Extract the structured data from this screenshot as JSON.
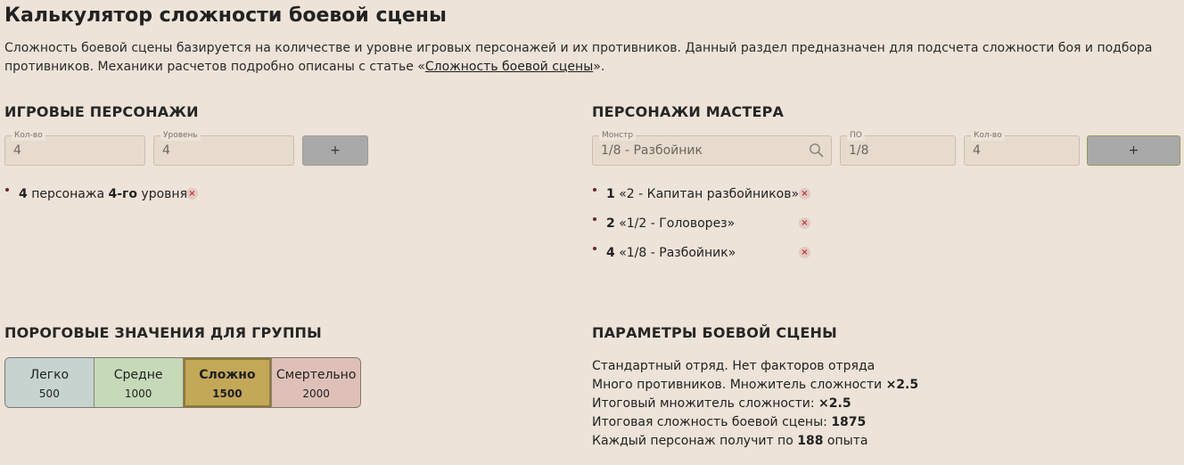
{
  "page": {
    "title": "Калькулятор сложности боевой сцены",
    "intro_text": "Сложность боевой сцены базируется на количестве и уровне игровых персонажей и их противников. Данный раздел предназначен для подсчета сложности боя и подбора противников. Механики расчетов подробно описаны с статье «",
    "intro_link": "Сложность боевой сцены",
    "intro_end": "»."
  },
  "players": {
    "heading": "ИГРОВЫЕ ПЕРСОНАЖИ",
    "count_label": "Кол-во",
    "count_value": "4",
    "level_label": "Уровень",
    "level_value": "4",
    "add_label": "+",
    "items": [
      {
        "count": "4",
        "mid": " персонажа ",
        "level": "4-го",
        "end": " уровня"
      }
    ]
  },
  "monsters": {
    "heading": "ПЕРСОНАЖИ МАСТЕРА",
    "monster_label": "Монстр",
    "monster_value": "1/8 - Разбойник",
    "cr_label": "ПО",
    "cr_value": "1/8",
    "count_label": "Кол-во",
    "count_value": "4",
    "add_label": "+",
    "items": [
      {
        "count": "1",
        "name": " «2 - Капитан разбойников»"
      },
      {
        "count": "2",
        "name": " «1/2 - Головорез»"
      },
      {
        "count": "4",
        "name": " «1/8 - Разбойник»"
      }
    ]
  },
  "thresholds": {
    "heading": "ПОРОГОВЫЕ ЗНАЧЕНИЯ ДЛЯ ГРУППЫ",
    "items": [
      {
        "name": "Легко",
        "value": "500"
      },
      {
        "name": "Средне",
        "value": "1000"
      },
      {
        "name": "Сложно",
        "value": "1500"
      },
      {
        "name": "Смертельно",
        "value": "2000"
      }
    ],
    "selected": "Сложно"
  },
  "params": {
    "heading": "ПАРАМЕТРЫ БОЕВОЙ СЦЕНЫ",
    "line1": "Стандартный отряд. Нет факторов отряда",
    "line2_text": "Много противников. Множитель сложности ",
    "line2_value": "×2.5",
    "line3_text": "Итоговый множитель сложности: ",
    "line3_value": "×2.5",
    "line4_text": "Итоговая сложность боевой сцены: ",
    "line4_value": "1875",
    "line5_text": "Каждый персонаж получит по ",
    "line5_value": "188",
    "line5_end": " опыта"
  },
  "icons": {
    "remove": "close-icon",
    "search": "search-icon",
    "remove_glyph": "×"
  },
  "colors": {
    "background": "#ede3d8",
    "easy": "#c6d3cf",
    "medium": "#c6d9b8",
    "hard": "#c3a857",
    "deadly": "#dfc0b8",
    "bullet": "#6b2424",
    "remove": "#c0392b"
  }
}
